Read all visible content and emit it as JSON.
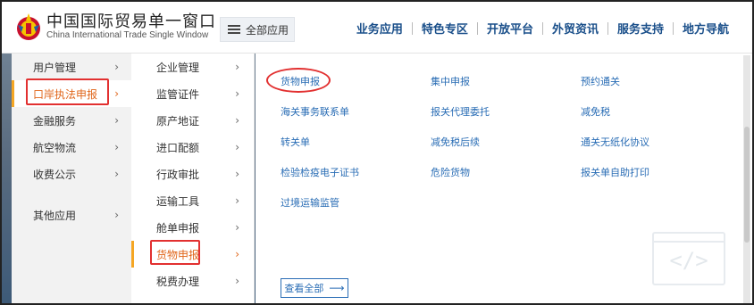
{
  "header": {
    "brand_cn": "中国国际贸易单一窗口",
    "brand_en": "China International Trade Single Window",
    "all_apps_label": "全部应用",
    "nav": [
      "业务应用",
      "特色专区",
      "开放平台",
      "外贸资讯",
      "服务支持",
      "地方导航"
    ]
  },
  "col1": {
    "items": [
      {
        "label": "用户管理",
        "chev": "›"
      },
      {
        "label": "口岸执法申报",
        "chev": "›"
      },
      {
        "label": "金融服务",
        "chev": "›"
      },
      {
        "label": "航空物流",
        "chev": "›"
      },
      {
        "label": "收费公示",
        "chev": "›"
      },
      {
        "label": "其他应用",
        "chev": "›"
      }
    ]
  },
  "col2": {
    "items": [
      {
        "label": "企业管理",
        "chev": "›"
      },
      {
        "label": "监管证件",
        "chev": "›"
      },
      {
        "label": "原产地证",
        "chev": "›"
      },
      {
        "label": "进口配额",
        "chev": "›"
      },
      {
        "label": "行政审批",
        "chev": "›"
      },
      {
        "label": "运输工具",
        "chev": "›"
      },
      {
        "label": "舱单申报",
        "chev": "›"
      },
      {
        "label": "货物申报",
        "chev": "›"
      },
      {
        "label": "税费办理",
        "chev": "›"
      }
    ]
  },
  "panel": {
    "links": [
      "货物申报",
      "集中申报",
      "预约通关",
      "海关事务联系单",
      "报关代理委托",
      "减免税",
      "转关单",
      "减免税后续",
      "通关无纸化协议",
      "检验检疫电子证书",
      "危险货物",
      "报关单自助打印",
      "过境运输监管"
    ],
    "view_all_label": "查看全部",
    "view_all_arrow": "⟶",
    "deco_symbol": "</>"
  },
  "colors": {
    "accent_orange": "#e0661b",
    "highlight_red": "#e23030",
    "link_blue": "#2a6db5",
    "nav_blue": "#1a4f8a"
  }
}
